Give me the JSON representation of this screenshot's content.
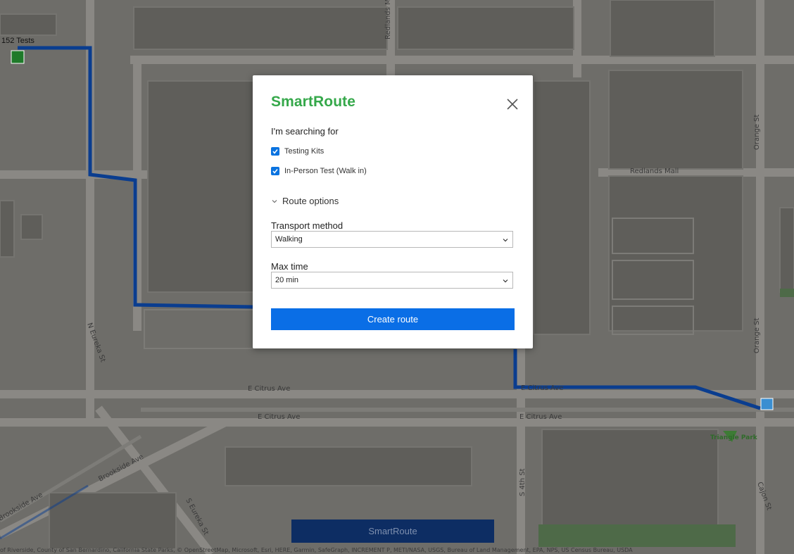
{
  "map": {
    "labels": {
      "tests_count": "152 Tests",
      "redlands_mall": "Redlands Mall",
      "redlands_top": "Redlands M",
      "orange_st_1": "Orange St",
      "orange_st_2": "Orange St",
      "n_eureka": "N Eureka St",
      "s_eureka": "S Eureka St",
      "e_citrus_1": "E Citrus Ave",
      "e_citrus_2": "E Citrus Ave",
      "e_citrus_3": "E Citrus Ave",
      "e_citrus_4": "E Citrus Ave",
      "brookside_1": "Brookside Ave",
      "brookside_2": "Brookside Ave",
      "s_4th": "S 4th St",
      "cajon": "Cajon St",
      "triangle_park": "Triangle Park"
    },
    "colors": {
      "route": "#0a3d8f",
      "start_marker": "#1f7a2a",
      "end_marker": "#3a8ed1"
    },
    "attribution": "of Riverside, County of San Bernardino, California State Parks, © OpenStreetMap, Microsoft, Esri, HERE, Garmin, SafeGraph, INCREMENT P, METI/NASA, USGS, Bureau of Land Management, EPA, NPS, US Census Bureau, USDA"
  },
  "modal": {
    "title": "SmartRoute",
    "searching_label": "I'm searching for",
    "options": [
      {
        "label": "Testing Kits",
        "checked": true
      },
      {
        "label": "In-Person Test (Walk in)",
        "checked": true
      }
    ],
    "route_options_label": "Route options",
    "transport": {
      "label": "Transport method",
      "value": "Walking"
    },
    "max_time": {
      "label": "Max time",
      "value": "20 min"
    },
    "create_button": "Create route",
    "close_icon": "close-icon"
  },
  "bottom_button": "SmartRoute"
}
